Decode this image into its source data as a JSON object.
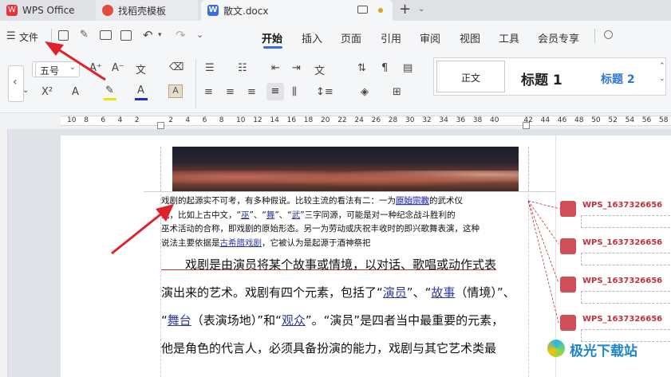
{
  "tabs": {
    "app": "WPS Office",
    "template": "找稻壳模板",
    "doc": "散文.docx",
    "add": "+"
  },
  "menubar": {
    "file": "文件",
    "items": [
      "开始",
      "插入",
      "页面",
      "引用",
      "审阅",
      "视图",
      "工具",
      "会员专享"
    ]
  },
  "toolbar": {
    "font_size": "五号",
    "styles": [
      "正文",
      "标题 1",
      "标题 2"
    ]
  },
  "ruler": {
    "numbers": [
      "10",
      "8",
      "6",
      "4",
      "2",
      "",
      "2",
      "4",
      "6",
      "8",
      "10",
      "12",
      "14",
      "16",
      "18",
      "20",
      "22",
      "24",
      "26",
      "28",
      "30",
      "32",
      "34",
      "36",
      "38",
      "40",
      "",
      "42",
      "44",
      "46",
      "48",
      "50",
      "52",
      "54",
      "56",
      "58"
    ]
  },
  "doc": {
    "small_lines": [
      [
        "戏剧的起源实不可考，有多种假说。比较主流的看法有二：一为",
        "原始宗教",
        "的武术仪"
      ],
      [
        "式，比如上古中文，“",
        "巫",
        "”、“",
        "舞",
        "”、“",
        "武",
        "”三字同源，可能是对一种纪念战斗胜利的"
      ],
      [
        "巫术活动的合称，即戏剧的原始形态。另一为劳动或庆祝丰收时的即兴歌舞表演，这种"
      ],
      [
        "说法主要依据是",
        "古希腊戏剧",
        "，它被认为是起源于酒神祭祀"
      ]
    ],
    "big_lines": [
      [
        "　　戏剧是由演员将某个故事或情境，以对话、歌唱或动作式表"
      ],
      [
        "演出来的艺术。戏剧有四个元素，包括了“",
        "演员",
        "”、“",
        "故事",
        "（情境）”、"
      ],
      [
        "“",
        "舞台",
        "（表演场地）”和“",
        "观众",
        "”。“演员”是四者当中最重要的元素，"
      ],
      [
        "他是角色的代言人，必须具备扮演的能力，戏剧与其它艺术类最"
      ]
    ]
  },
  "comments": [
    {
      "author": "WPS_1637326656"
    },
    {
      "author": "WPS_1637326656"
    },
    {
      "author": "WPS_1637326656"
    },
    {
      "author": "WPS_1637326656"
    }
  ],
  "watermark": {
    "text": "极光下载站"
  },
  "colors": {
    "accent": "#e0212c",
    "brand_red": "#c0313b",
    "link": "#2e3a9b"
  }
}
